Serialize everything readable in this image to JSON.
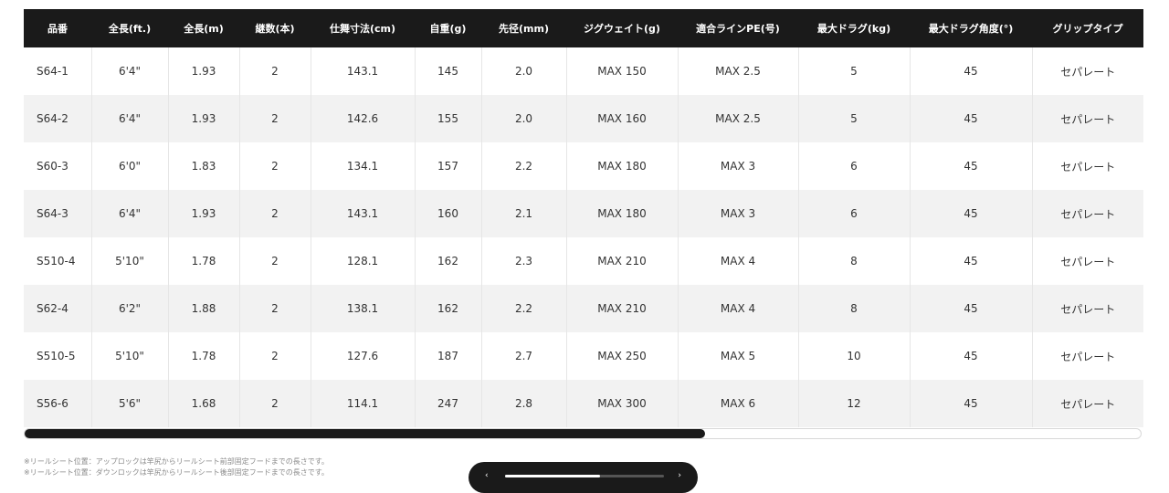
{
  "table": {
    "headers": [
      "品番",
      "全長(ft.)",
      "全長(m)",
      "継数(本)",
      "仕舞寸法(cm)",
      "自重(g)",
      "先径(mm)",
      "ジグウェイト(g)",
      "適合ラインPE(号)",
      "最大ドラグ(kg)",
      "最大ドラグ角度(°)",
      "グリップタイプ"
    ],
    "rows": [
      [
        "S64-1",
        "6'4\"",
        "1.93",
        "2",
        "143.1",
        "145",
        "2.0",
        "MAX 150",
        "MAX 2.5",
        "5",
        "45",
        "セパレート"
      ],
      [
        "S64-2",
        "6'4\"",
        "1.93",
        "2",
        "142.6",
        "155",
        "2.0",
        "MAX 160",
        "MAX 2.5",
        "5",
        "45",
        "セパレート"
      ],
      [
        "S60-3",
        "6'0\"",
        "1.83",
        "2",
        "134.1",
        "157",
        "2.2",
        "MAX 180",
        "MAX 3",
        "6",
        "45",
        "セパレート"
      ],
      [
        "S64-3",
        "6'4\"",
        "1.93",
        "2",
        "143.1",
        "160",
        "2.1",
        "MAX 180",
        "MAX 3",
        "6",
        "45",
        "セパレート"
      ],
      [
        "S510-4",
        "5'10\"",
        "1.78",
        "2",
        "128.1",
        "162",
        "2.3",
        "MAX 210",
        "MAX 4",
        "8",
        "45",
        "セパレート"
      ],
      [
        "S62-4",
        "6'2\"",
        "1.88",
        "2",
        "138.1",
        "162",
        "2.2",
        "MAX 210",
        "MAX 4",
        "8",
        "45",
        "セパレート"
      ],
      [
        "S510-5",
        "5'10\"",
        "1.78",
        "2",
        "127.6",
        "187",
        "2.7",
        "MAX 250",
        "MAX 5",
        "10",
        "45",
        "セパレート"
      ],
      [
        "S56-6",
        "5'6\"",
        "1.68",
        "2",
        "114.1",
        "247",
        "2.8",
        "MAX 300",
        "MAX 6",
        "12",
        "45",
        "セパレート"
      ]
    ]
  },
  "scroll": {
    "position_fraction": 0.61
  },
  "notes": [
    "※リールシート位置：アップロックは竿尻からリールシート前部固定フードまでの長さです。",
    "※リールシート位置：ダウンロックは竿尻からリールシート後部固定フードまでの長さです。"
  ],
  "pager": {
    "prev_icon": "‹",
    "next_icon": "›",
    "progress_fraction": 0.6
  }
}
